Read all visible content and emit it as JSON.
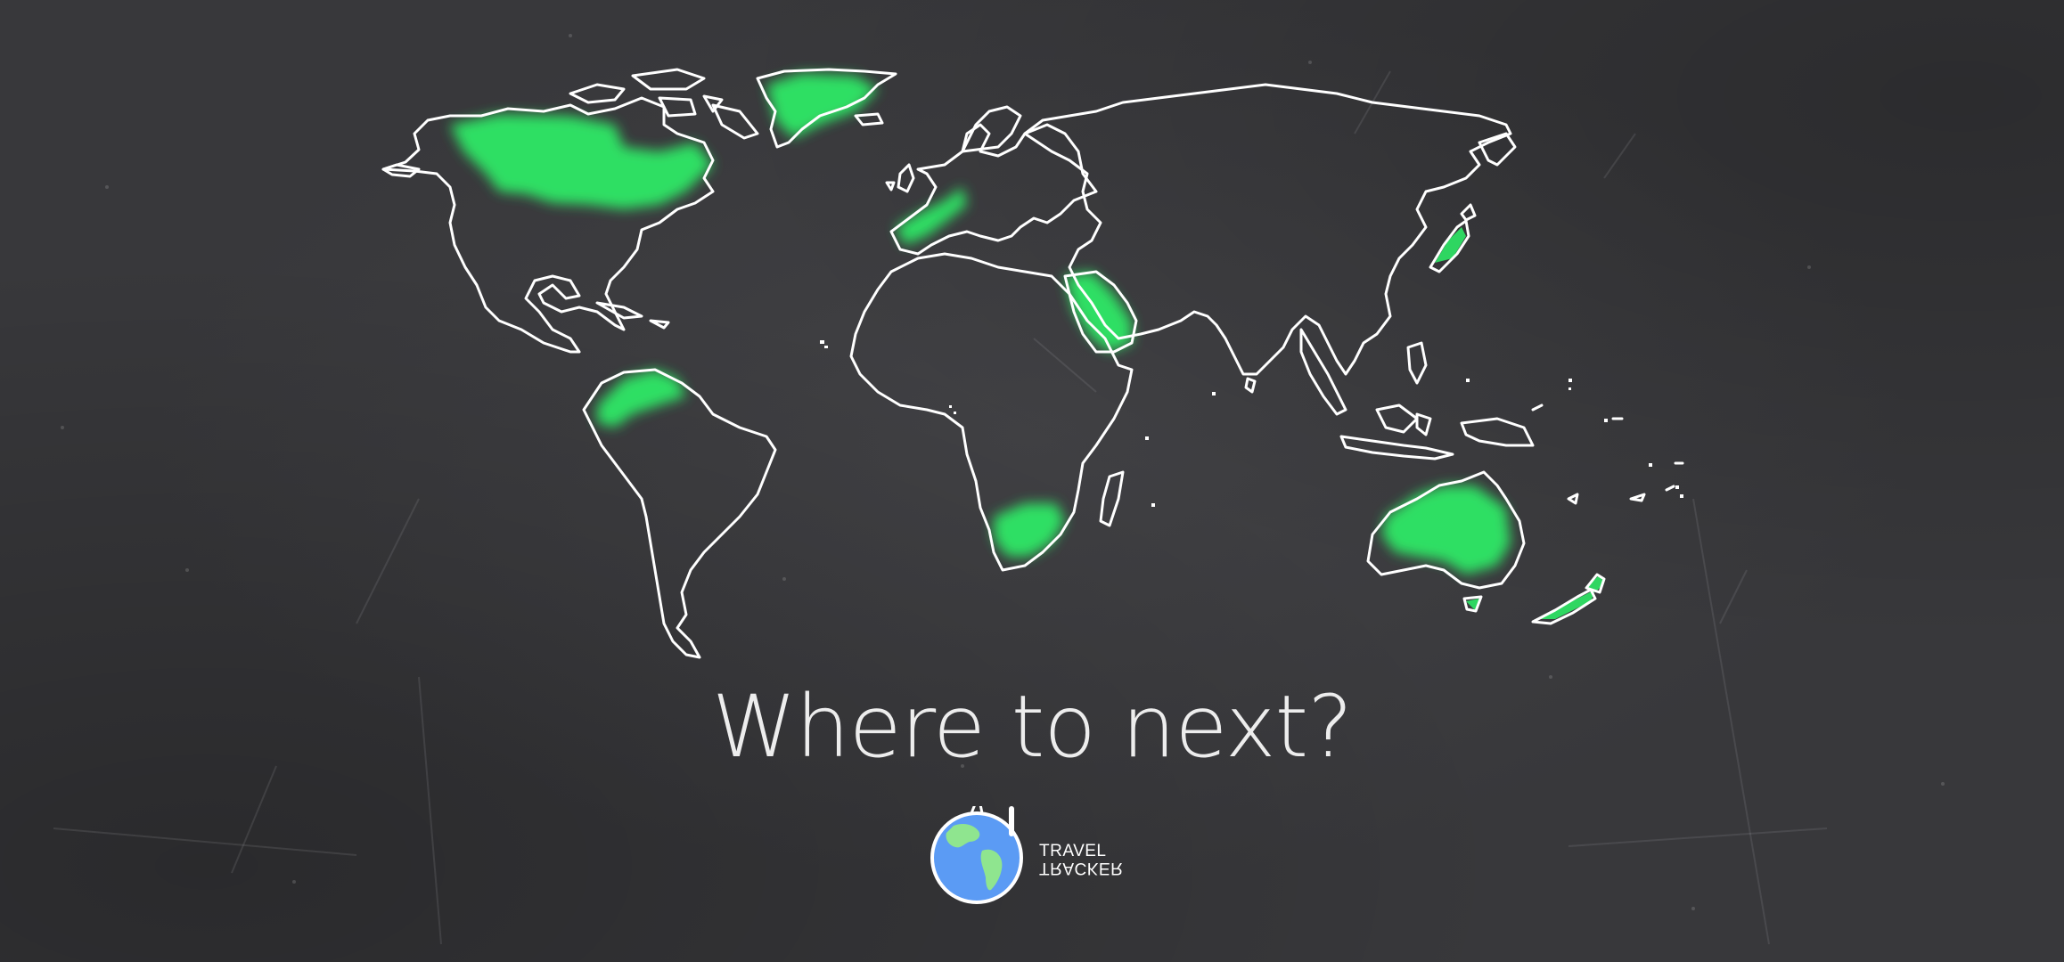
{
  "headline": "Where to next?",
  "logo": {
    "line1": "TRAVEL",
    "line2": "TRACKER",
    "icon": "globe-icon"
  },
  "colors": {
    "background": "#38383b",
    "visited": "#2ee866",
    "outline": "#ffffff",
    "globe_ocean": "#5b9bf4",
    "globe_land": "#8fe58f"
  },
  "visited_regions": [
    "Canada",
    "Greenland",
    "Western Europe",
    "Arabian Peninsula",
    "Northern South America",
    "Southern Africa",
    "Australia",
    "New Zealand",
    "Japan"
  ]
}
